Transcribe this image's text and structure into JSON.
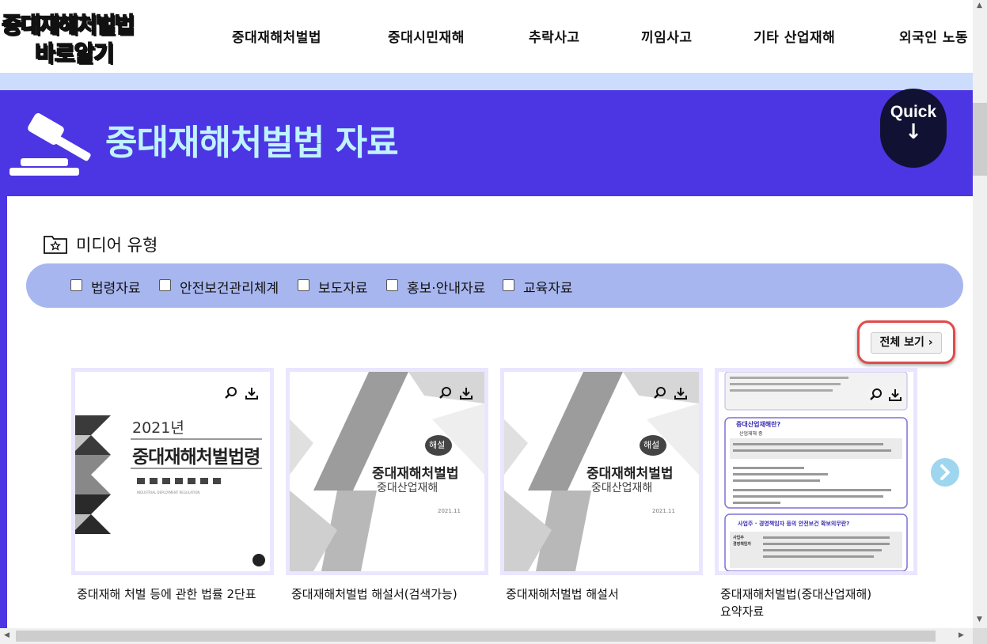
{
  "logo": {
    "line1": "중대재해처벌법",
    "line2": "바로알기"
  },
  "nav": {
    "items": [
      "중대재해처벌법",
      "중대시민재해",
      "추락사고",
      "끼임사고",
      "기타 산업재해",
      "외국인 노동"
    ]
  },
  "banner": {
    "title": "중대재해처벌법 자료",
    "quick_label": "Quick",
    "quick_arrow": "↓"
  },
  "media": {
    "title": "미디어 유형",
    "filters": [
      "법령자료",
      "안전보건관리체계",
      "보도자료",
      "홍보·안내자료",
      "교육자료"
    ]
  },
  "view_all": "전체 보기",
  "cards": [
    {
      "caption": "중대재해 처벌 등에 관한 법률 2단표",
      "thumb": {
        "year": "2021년",
        "title": "중대재해처벌법령",
        "subtitle": "INDUSTRIAL DEPLOYMENT REGULATION"
      }
    },
    {
      "caption": "중대재해처벌법 해설서(검색가능)",
      "thumb": {
        "badge": "해설",
        "title": "중대재해처벌법",
        "subtitle": "중대산업재해",
        "date": "2021.11"
      }
    },
    {
      "caption": "중대재해처벌법 해설서",
      "thumb": {
        "badge": "해설",
        "title": "중대재해처벌법",
        "subtitle": "중대산업재해",
        "date": "2021.11"
      }
    },
    {
      "caption_line1": "중대재해처벌법(중대산업재해)",
      "caption_line2": "요약자료",
      "thumb": {
        "heading1": "중대산업재해란?",
        "item1": "산업재해 중",
        "heading2": "사업주 · 경영책임자 등의 안전보건 확보의무란?",
        "tag1": "사업주",
        "tag2": "경영책임자"
      }
    }
  ]
}
